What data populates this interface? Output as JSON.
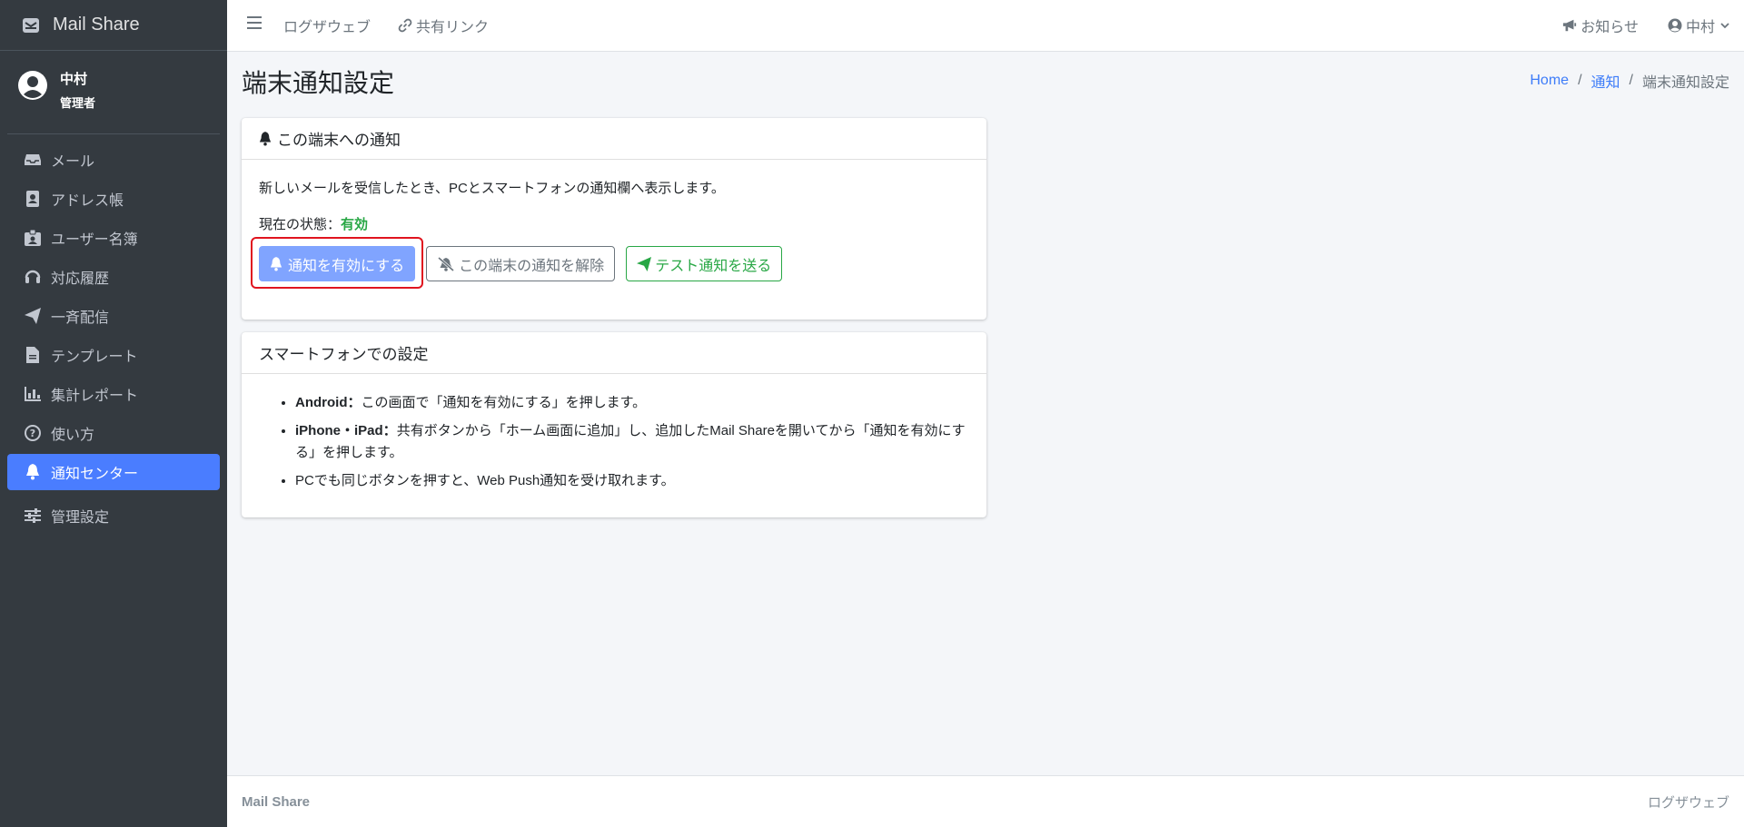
{
  "brand": {
    "name": "Mail Share"
  },
  "user": {
    "name": "中村",
    "role": "管理者"
  },
  "sidebar": {
    "items": [
      {
        "label": "メール",
        "icon": "inbox-icon"
      },
      {
        "label": "アドレス帳",
        "icon": "address-book-icon"
      },
      {
        "label": "ユーザー名簿",
        "icon": "id-badge-icon"
      },
      {
        "label": "対応履歴",
        "icon": "headset-icon"
      },
      {
        "label": "一斉配信",
        "icon": "paper-plane-icon"
      },
      {
        "label": "テンプレート",
        "icon": "file-icon"
      },
      {
        "label": "集計レポート",
        "icon": "bar-chart-icon"
      },
      {
        "label": "使い方",
        "icon": "question-circle-icon"
      },
      {
        "label": "通知センター",
        "icon": "bell-icon",
        "active": true
      },
      {
        "label": "管理設定",
        "icon": "sliders-icon"
      }
    ]
  },
  "topbar": {
    "links": [
      "ログザウェブ",
      "共有リンク"
    ],
    "notices": "お知らせ",
    "user": "中村"
  },
  "page": {
    "title": "端末通知設定",
    "breadcrumb": [
      "Home",
      "通知",
      "端末通知設定"
    ]
  },
  "card1": {
    "header": "この端末への通知",
    "description": "新しいメールを受信したとき、PCとスマートフォンの通知欄へ表示します。",
    "state_label": "現在の状態：",
    "state_value": "有効",
    "buttons": {
      "enable": "通知を有効にする",
      "disable": "この端末の通知を解除",
      "test": "テスト通知を送る"
    }
  },
  "card2": {
    "header": "スマートフォンでの設定",
    "items": [
      {
        "bold": "Android：",
        "text": "この画面で「通知を有効にする」を押します。"
      },
      {
        "bold": "iPhone・iPad：",
        "text": "共有ボタンから「ホーム画面に追加」し、追加したMail Shareを開いてから「通知を有効にする」を押します。"
      },
      {
        "bold": "",
        "text": "PCでも同じボタンを押すと、Web Push通知を受け取れます。"
      }
    ]
  },
  "footer": {
    "left": "Mail Share",
    "right": "ログザウェブ"
  },
  "colors": {
    "sidebar": "#343a40",
    "accent": "#4a7dff",
    "success": "#28a745",
    "highlight": "#e0141f"
  }
}
